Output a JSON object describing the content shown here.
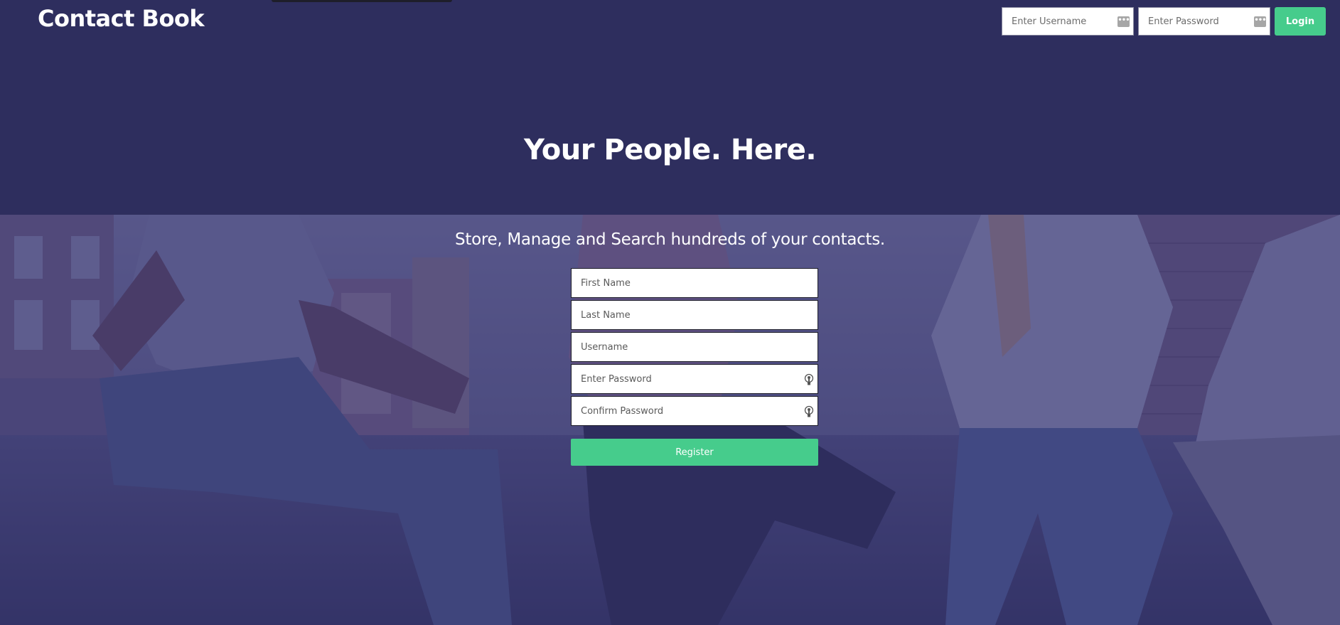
{
  "header": {
    "brand": "Contact Book",
    "login": {
      "username_placeholder": "Enter Username",
      "password_placeholder": "Enter Password",
      "login_label": "Login",
      "field_icon": "password-manager-icon"
    }
  },
  "hero": {
    "title": "Your People. Here.",
    "tagline": "Store, Manage and Search hundreds of your contacts."
  },
  "register": {
    "first_name_placeholder": "First Name",
    "last_name_placeholder": "Last Name",
    "username_placeholder": "Username",
    "password_placeholder": "Enter Password",
    "confirm_password_placeholder": "Confirm Password",
    "register_label": "Register",
    "password_icon": "key-icon"
  },
  "colors": {
    "header_bg": "#2e2e5e",
    "accent": "#46cc8c",
    "text_light": "#ffffff"
  }
}
